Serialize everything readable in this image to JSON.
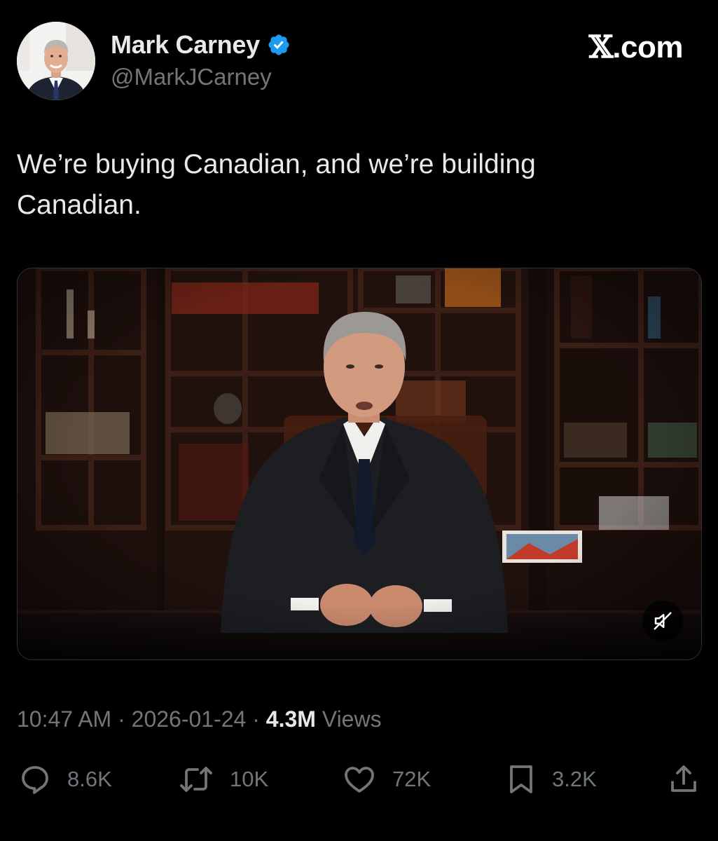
{
  "author": {
    "display_name": "Mark Carney",
    "handle": "@MarkJCarney",
    "verified_icon": "verified-badge-icon",
    "avatar": "avatar"
  },
  "brand": {
    "x_glyph": "𝕏",
    "domain": ".com"
  },
  "tweet": {
    "text": "We’re buying Canadian, and we’re building\nCanadian."
  },
  "media": {
    "type": "video",
    "mute_icon": "muted-speaker-icon"
  },
  "meta": {
    "time": "10:47 AM",
    "separator": " · ",
    "date": "2026-01-24",
    "views_count": "4.3M",
    "views_label": " Views"
  },
  "actions": {
    "replies": "8.6K",
    "reposts": "10K",
    "likes": "72K",
    "bookmarks": "3.2K"
  },
  "colors": {
    "background": "#000000",
    "text": "#e7e9ea",
    "secondary": "#71767b",
    "verified": "#1d9bf0"
  }
}
